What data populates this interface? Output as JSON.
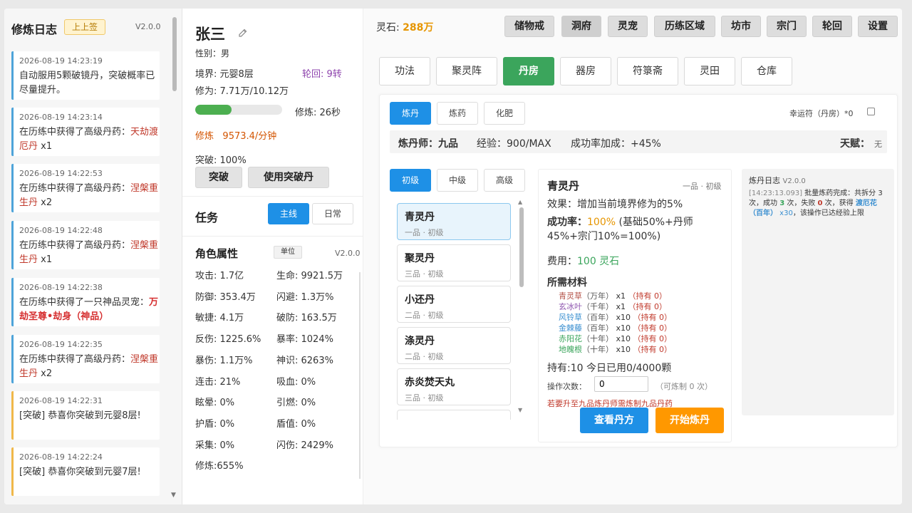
{
  "log_panel": {
    "title": "修炼日志",
    "sign_label": "上上签",
    "version": "V2.0.0",
    "entries": [
      {
        "time": "2026-08-19 14:23:19",
        "text": "自动服用5颗破镜丹，突破概率已尽量提升。"
      },
      {
        "time": "2026-08-19 14:23:14",
        "prefix": "在历练中获得了高级丹药：",
        "item": "天劫渡厄丹",
        "suffix": " x1"
      },
      {
        "time": "2026-08-19 14:22:53",
        "prefix": "在历练中获得了高级丹药：",
        "item": "涅槃重生丹",
        "suffix": " x2"
      },
      {
        "time": "2026-08-19 14:22:48",
        "prefix": "在历练中获得了高级丹药：",
        "item": "涅槃重生丹",
        "suffix": " x1"
      },
      {
        "time": "2026-08-19 14:22:38",
        "prefix": "在历练中获得了一只神品灵宠：",
        "item": "万劫圣尊•劫身（神品）",
        "suffix": ""
      },
      {
        "time": "2026-08-19 14:22:35",
        "prefix": "在历练中获得了高级丹药：",
        "item": "涅槃重生丹",
        "suffix": " x2"
      },
      {
        "time": "2026-08-19 14:22:31",
        "text": "[突破] 恭喜你突破到元婴8层!"
      },
      {
        "time": "2026-08-19 14:22:24",
        "text": "[突破] 恭喜你突破到元婴7层!"
      }
    ]
  },
  "character": {
    "name": "张三",
    "gender": "性别：男",
    "realm": "境界: 元婴8层",
    "reincarnation": "轮回: 9转",
    "cultivation": "修为: 7.71万/10.12万",
    "progress": 0.42,
    "cultivate_timer": "修炼:   26秒",
    "rate_label": "修炼",
    "rate_value": "9573.4/分钟",
    "breakthrough": "突破: 100%",
    "break_button": "突破",
    "use_pill_button": "使用突破丹"
  },
  "tasks": {
    "title": "任务",
    "tab_main": "主线",
    "tab_daily": "日常"
  },
  "attributes": {
    "title": "角色属性",
    "unit_label": "单位",
    "version": "V2.0.0",
    "items": [
      [
        "攻击: 1.7亿",
        "生命: 9921.5万"
      ],
      [
        "防御: 353.4万",
        "闪避: 1.3万%"
      ],
      [
        "敏捷: 4.1万",
        "破防: 163.5万"
      ],
      [
        "反伤: 1225.6%",
        "暴率: 1024%"
      ],
      [
        "暴伤: 1.1万%",
        "神识: 6263%"
      ],
      [
        "连击: 21%",
        "吸血: 0%"
      ],
      [
        "眩晕: 0%",
        "引燃: 0%"
      ],
      [
        "护盾: 0%",
        "盾值: 0%"
      ],
      [
        "采集: 0%",
        "闪伤: 2429%"
      ],
      [
        "修炼:655%",
        ""
      ]
    ]
  },
  "topbar": {
    "stone_label": "灵石:",
    "stone_value": "288万",
    "buttons": [
      "储物戒",
      "洞府",
      "灵宠",
      "历练区域",
      "坊市",
      "宗门",
      "轮回",
      "设置"
    ]
  },
  "nav": {
    "tabs": [
      "功法",
      "聚灵阵",
      "丹房",
      "器房",
      "符箓斋",
      "灵田",
      "仓库"
    ],
    "active_index": 2
  },
  "alchemy": {
    "subtabs": [
      "炼丹",
      "炼药",
      "化肥"
    ],
    "lucky_label": "幸运符（丹房）*0",
    "info": {
      "master": "炼丹师：九品",
      "exp": "经验：900/MAX",
      "bonus": "成功率加成：+45%",
      "talent_label": "天赋：",
      "talent_value": "无"
    },
    "grades": [
      "初级",
      "中级",
      "高级"
    ],
    "recipes": [
      {
        "name": "青灵丹",
        "grade": "一品 · 初级"
      },
      {
        "name": "聚灵丹",
        "grade": "三品 · 初级"
      },
      {
        "name": "小还丹",
        "grade": "二品 · 初级"
      },
      {
        "name": "涤灵丹",
        "grade": "二品 · 初级"
      },
      {
        "name": "赤炎焚天丸",
        "grade": "三品 · 初级"
      }
    ],
    "detail": {
      "name": "青灵丹",
      "grade": "一品 · 初级",
      "effect": "效果：增加当前境界修为的5%",
      "success_label": "成功率：",
      "success_value": "100%",
      "success_rest": " (基础50%+丹师45%+宗门10%=100%)",
      "cost_label": "费用：",
      "cost_value": "100 灵石",
      "materials_title": "所需材料",
      "materials": [
        {
          "name": "青灵草",
          "age": "（万年）",
          "qty": "x1",
          "own": "（持有 0）",
          "color": "#b5544a"
        },
        {
          "name": "玄冰叶",
          "age": "（千年）",
          "qty": "x1",
          "own": "（持有 0）",
          "color": "#8e56b0"
        },
        {
          "name": "风铃草",
          "age": "（百年）",
          "qty": "x10",
          "own": "（持有 0）",
          "color": "#3a8fd0"
        },
        {
          "name": "金棘藤",
          "age": "（百年）",
          "qty": "x10",
          "own": "（持有 0）",
          "color": "#3a8fd0"
        },
        {
          "name": "赤阳花",
          "age": "（十年）",
          "qty": "x10",
          "own": "（持有 0）",
          "color": "#3ba55c"
        },
        {
          "name": "地魄根",
          "age": "（十年）",
          "qty": "x10",
          "own": "（持有 0）",
          "color": "#3ba55c"
        }
      ],
      "hold": "持有:10 今日已用0/4000颗",
      "op_label": "操作次数：",
      "op_value": "0",
      "op_hint": "（可炼制 0 次）",
      "warning": "若要升至九品炼丹师需炼制九品丹药",
      "view_button": "查看丹方",
      "start_button": "开始炼丹"
    },
    "log": {
      "title": "炼丹日志",
      "version": "V2.0.0",
      "time": "[14:23:13.093]",
      "t1": " 批量炼药完成：共拆分 3 次，成功 ",
      "succ": "3",
      "t2": " 次，失败 ",
      "fail": "0",
      "t3": " 次，获得 ",
      "item": "渡厄花（百年）",
      "qty": " x30",
      "t4": "，该操作已达经验上限"
    }
  }
}
